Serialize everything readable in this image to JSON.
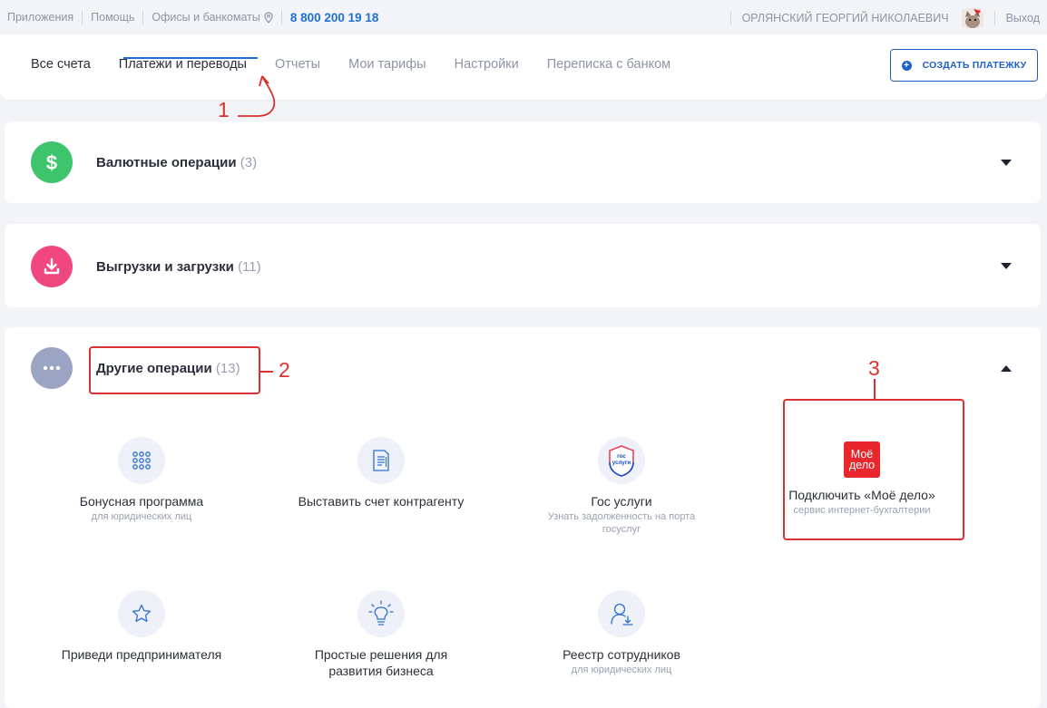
{
  "topbar": {
    "apps": "Приложения",
    "help": "Помощь",
    "offices": "Офисы и банкоматы",
    "phone": "8 800 200 19 18",
    "user": "ОРЛЯНСКИЙ ГЕОРГИЙ НИКОЛАЕВИЧ",
    "logout": "Выход"
  },
  "nav": {
    "tabs": [
      {
        "label": "Все счета"
      },
      {
        "label": "Платежи и переводы"
      },
      {
        "label": "Отчеты"
      },
      {
        "label": "Мои тарифы"
      },
      {
        "label": "Настройки"
      },
      {
        "label": "Переписка с банком"
      }
    ],
    "active_tab": "Платежи и переводы",
    "create_button": "СОЗДАТЬ ПЛАТЕЖКУ"
  },
  "sections": [
    {
      "title": "Валютные операции",
      "count": "(3)",
      "icon": "dollar-icon",
      "color": "#3ec46d",
      "expanded": false
    },
    {
      "title": "Выгрузки и загрузки",
      "count": "(11)",
      "icon": "download-icon",
      "color": "#f0487e",
      "expanded": false
    },
    {
      "title": "Другие операции",
      "count": "(13)",
      "icon": "more-dots-icon",
      "color": "#9ba4c2",
      "expanded": true
    }
  ],
  "other_items": [
    {
      "title": "Бонусная программа",
      "subtitle": "для юридических лиц",
      "icon": "grid-dots-icon"
    },
    {
      "title": "Выставить счет контрагенту",
      "subtitle": "",
      "icon": "invoice-icon"
    },
    {
      "title": "Гос услуги",
      "subtitle": "Узнать задолженность на порта госуслуг",
      "icon": "gosuslugi-icon",
      "logo_text": "гос услуги"
    },
    {
      "title": "Подключить «Моё дело»",
      "subtitle": "сервис интернет-бухгалтерии",
      "icon": "moe-delo-icon",
      "logo_text": "Моё дело"
    },
    {
      "title": "Приведи предпринимателя",
      "subtitle": "",
      "icon": "star-icon"
    },
    {
      "title": "Простые решения для развития бизнеса",
      "subtitle": "",
      "icon": "lightbulb-icon"
    },
    {
      "title": "Реестр сотрудников",
      "subtitle": "для юридических лиц",
      "icon": "user-download-icon"
    }
  ],
  "annotations": [
    "1",
    "2",
    "3"
  ],
  "colors": {
    "accent": "#1f6fd6",
    "annotation": "#d9312f",
    "moe_delo": "#e8262c"
  }
}
